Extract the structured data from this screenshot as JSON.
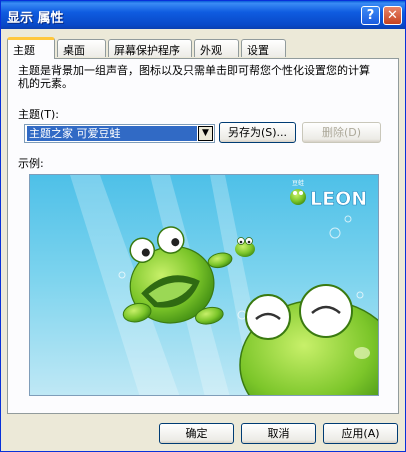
{
  "window": {
    "title": "显示 属性",
    "help_glyph": "?",
    "close_glyph": "✕"
  },
  "tabs": [
    {
      "label": "主题",
      "active": true
    },
    {
      "label": "桌面",
      "active": false
    },
    {
      "label": "屏幕保护程序",
      "active": false
    },
    {
      "label": "外观",
      "active": false
    },
    {
      "label": "设置",
      "active": false
    }
  ],
  "themes": {
    "description": "主题是背景加一组声音，图标以及只需单击即可帮您个性化设置您的计算机的元素。",
    "theme_label": "主题(T):",
    "selected_theme": "主题之家 可爱豆蛙",
    "save_as_label": "另存为(S)...",
    "delete_label": "删除(D)",
    "preview_label": "示例:",
    "preview_brand": "LEON",
    "preview_brand_small": "豆蛙"
  },
  "footer": {
    "ok_label": "确定",
    "cancel_label": "取消",
    "apply_label": "应用(A)"
  },
  "colors": {
    "titlebar": "#0a54d8",
    "selection": "#316ac5",
    "tab_highlight": "#ffc73c",
    "frog_green": "#7cc62a"
  },
  "icons": [
    "help-icon",
    "close-icon",
    "chevron-down-icon"
  ]
}
